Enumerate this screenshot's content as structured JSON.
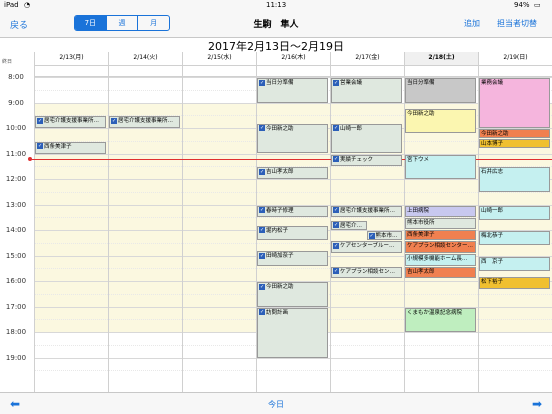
{
  "status": {
    "device": "iPad",
    "wifi": "wifi",
    "time": "11:13",
    "battery": "94%"
  },
  "nav": {
    "back": "戻る",
    "seg": [
      "7日",
      "週",
      "月"
    ],
    "title": "生駒　隼人",
    "add": "追加",
    "switch": "担当者切替"
  },
  "range": "2017年2月13日～2月19日",
  "time_col_label": "終日",
  "days": [
    "2/13(月)",
    "2/14(火)",
    "2/15(水)",
    "2/16(木)",
    "2/17(金)",
    "2/18(土)",
    "2/19(日)"
  ],
  "hours": [
    "8:00",
    "9:00",
    "10:00",
    "11:00",
    "12:00",
    "13:00",
    "14:00",
    "15:00",
    "16:00",
    "17:00",
    "18:00",
    "19:00"
  ],
  "events": [
    {
      "day": 0,
      "start": 9.5,
      "end": 10.0,
      "title": "居宅介護支援事業所…",
      "color": "#dfe8df",
      "check": true
    },
    {
      "day": 0,
      "start": 10.5,
      "end": 11.0,
      "title": "西条美津子",
      "color": "#dfe8df",
      "check": true
    },
    {
      "day": 1,
      "start": 9.5,
      "end": 10.0,
      "title": "居宅介護支援事業所…",
      "color": "#dfe8df",
      "check": true
    },
    {
      "day": 3,
      "start": 8.0,
      "end": 9.0,
      "title": "当日分準備",
      "color": "#dfe8df",
      "check": true
    },
    {
      "day": 3,
      "start": 9.8,
      "end": 11.0,
      "title": "今田新之助",
      "color": "#dfe8df",
      "check": true
    },
    {
      "day": 3,
      "start": 11.5,
      "end": 12.0,
      "title": "吉山孝太郎",
      "color": "#dfe8df",
      "check": true
    },
    {
      "day": 3,
      "start": 13.0,
      "end": 13.5,
      "title": "春時子修理",
      "color": "#dfe8df",
      "check": true
    },
    {
      "day": 3,
      "start": 13.8,
      "end": 14.4,
      "title": "堀内松子",
      "color": "#dfe8df",
      "check": true
    },
    {
      "day": 3,
      "start": 14.8,
      "end": 15.4,
      "title": "田崎加奈子",
      "color": "#dfe8df",
      "check": true
    },
    {
      "day": 3,
      "start": 16.0,
      "end": 17.0,
      "title": "今田新之助",
      "color": "#dfe8df",
      "check": true
    },
    {
      "day": 3,
      "start": 17.0,
      "end": 19.0,
      "title": "訪問計画",
      "color": "#dfe8df",
      "check": true
    },
    {
      "day": 4,
      "start": 8.0,
      "end": 9.0,
      "title": "営業会議",
      "color": "#dfe8df",
      "check": true
    },
    {
      "day": 4,
      "start": 9.8,
      "end": 11.0,
      "title": "山崎一郎",
      "color": "#dfe8df",
      "check": true
    },
    {
      "day": 4,
      "start": 11.0,
      "end": 11.5,
      "title": "実績チェック",
      "color": "#dfe8df",
      "check": true
    },
    {
      "day": 4,
      "start": 13.0,
      "end": 13.5,
      "title": "居宅介護支援事業所…",
      "color": "#dfe8df",
      "check": true
    },
    {
      "day": 4,
      "start": 13.6,
      "end": 14.0,
      "title": "居宅介…",
      "color": "#dfe8df",
      "check": true,
      "half": "left"
    },
    {
      "day": 4,
      "start": 14.0,
      "end": 14.4,
      "title": "熊本市…",
      "color": "#dfe8df",
      "check": true,
      "half": "right"
    },
    {
      "day": 4,
      "start": 14.4,
      "end": 14.9,
      "title": "ケアセンターブルー…",
      "color": "#dfe8df",
      "check": true
    },
    {
      "day": 4,
      "start": 15.4,
      "end": 15.9,
      "title": "ケアプラン相談セン…",
      "color": "#dfe8df",
      "check": true
    },
    {
      "day": 5,
      "start": 8.0,
      "end": 9.0,
      "title": "当日分準備",
      "color": "#c8c8c8",
      "check": false
    },
    {
      "day": 5,
      "start": 9.2,
      "end": 10.2,
      "title": "今田新之助",
      "color": "#fbf6b0",
      "check": false
    },
    {
      "day": 5,
      "start": 11.0,
      "end": 12.0,
      "title": "宮下ウメ",
      "color": "#c5f0f0",
      "check": false
    },
    {
      "day": 5,
      "start": 13.0,
      "end": 13.5,
      "title": "上田病院",
      "color": "#c8c8ef",
      "check": false
    },
    {
      "day": 5,
      "start": 13.5,
      "end": 13.95,
      "title": "熊本市役所",
      "color": "#dfe8df",
      "check": false
    },
    {
      "day": 5,
      "start": 13.95,
      "end": 14.4,
      "title": "西条美津子",
      "color": "#f08050",
      "check": false
    },
    {
      "day": 5,
      "start": 14.4,
      "end": 14.9,
      "title": "ケアプラン相談センター…",
      "color": "#f08050",
      "check": false
    },
    {
      "day": 5,
      "start": 14.9,
      "end": 15.4,
      "title": "小規模多機能ホーム長…",
      "color": "#c5f0f0",
      "check": false
    },
    {
      "day": 5,
      "start": 15.4,
      "end": 15.9,
      "title": "吉山孝太郎",
      "color": "#f08050",
      "check": false
    },
    {
      "day": 5,
      "start": 17.0,
      "end": 18.0,
      "title": "くまもか温泉記念病院",
      "color": "#bfeebf",
      "check": false
    },
    {
      "day": 6,
      "start": 8.0,
      "end": 10.0,
      "title": "業務会議",
      "color": "#f5b5dd",
      "check": false
    },
    {
      "day": 6,
      "start": 10.0,
      "end": 10.4,
      "title": "今田新之助",
      "color": "#f08050",
      "check": false
    },
    {
      "day": 6,
      "start": 10.4,
      "end": 10.8,
      "title": "山本博子",
      "color": "#f0c030",
      "check": false
    },
    {
      "day": 6,
      "start": 11.5,
      "end": 12.5,
      "title": "石井広志",
      "color": "#c5f0f0",
      "check": false
    },
    {
      "day": 6,
      "start": 13.0,
      "end": 13.6,
      "title": "山崎一郎",
      "color": "#c5f0f0",
      "check": false
    },
    {
      "day": 6,
      "start": 14.0,
      "end": 14.6,
      "title": "梅北恭子",
      "color": "#c5f0f0",
      "check": false
    },
    {
      "day": 6,
      "start": 15.0,
      "end": 15.6,
      "title": "西　京子",
      "color": "#c5f0f0",
      "check": false
    },
    {
      "day": 6,
      "start": 15.8,
      "end": 16.3,
      "title": "松下裕子",
      "color": "#f0c030",
      "check": false
    }
  ],
  "toolbar": {
    "prev": "⬅",
    "today": "今日",
    "next": "➡"
  }
}
